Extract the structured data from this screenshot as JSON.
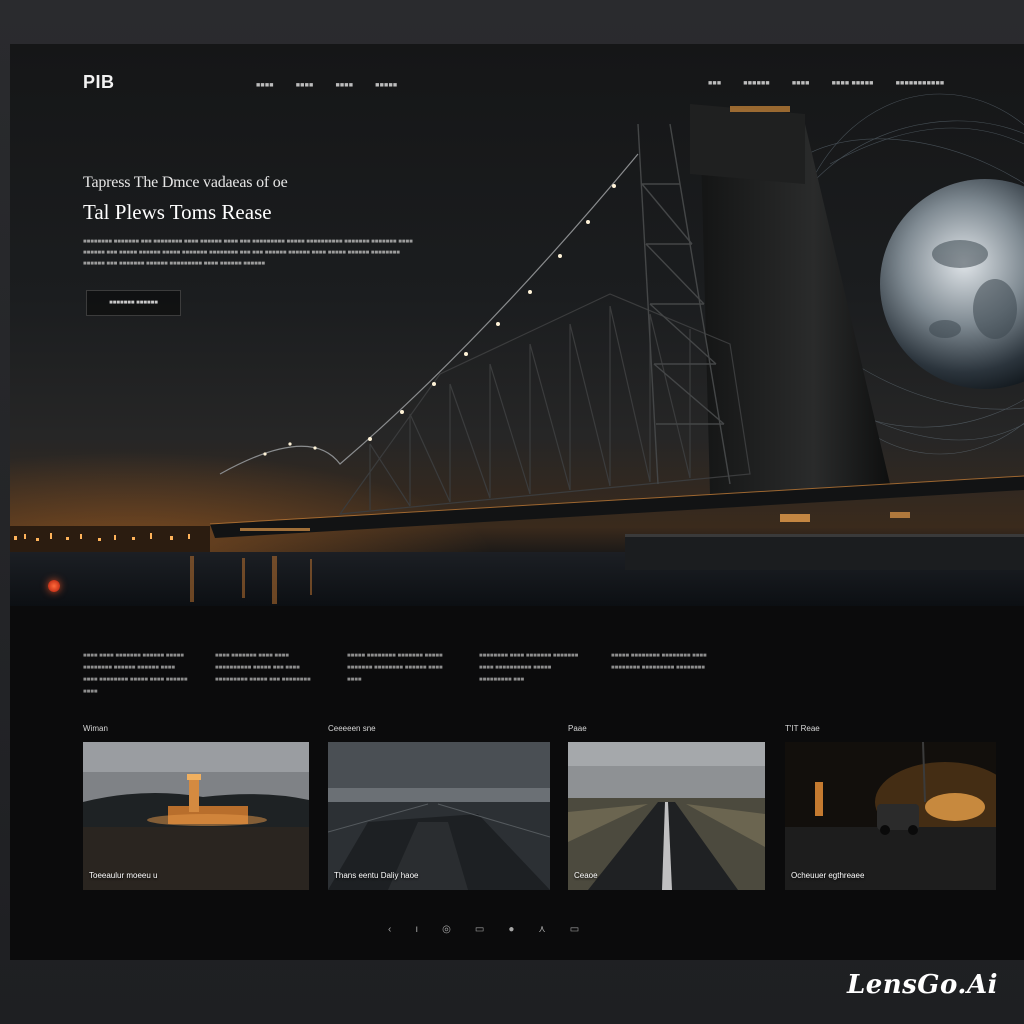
{
  "header": {
    "logo": "PIB",
    "nav_left": [
      "■■■■",
      "■■■■",
      "■■■■",
      "■■■■■"
    ],
    "nav_right": [
      "■■■",
      "■■■■■■",
      "■■■■",
      "■■■■ ■■■■■",
      "■■■■■■■■■■■"
    ]
  },
  "hero": {
    "kicker": "Tapress The Dmce vadaeas of oe",
    "title": "Tal Plews Toms Rease",
    "body": "■■■■■■■■ ■■■■■■■ ■■■ ■■■■■■■■ ■■■■ ■■■■■■ ■■■■ ■■■ ■■■■■■■■■ ■■■■■ ■■■■■■■■■■ ■■■■■■■ ■■■■■■■ ■■■■ ■■■■■■ ■■■ ■■■■■ ■■■■■■ ■■■■■ ■■■■■■■ ■■■■■■■■ ■■■ ■■■ ■■■■■■ ■■■■■■ ■■■■ ■■■■■ ■■■■■■ ■■■■■■■■ ■■■■■■ ■■■ ■■■■■■■ ■■■■■■ ■■■■■■■■■ ■■■■ ■■■■■■ ■■■■■■",
    "cta": "■■■■■■■ ■■■■■■"
  },
  "features": [
    {
      "text": "■■■■ ■■■■ ■■■■■■■ ■■■■■■ ■■■■■ ■■■■■■■■ ■■■■■■ ■■■■■■ ■■■■ ■■■■ ■■■■■■■■ ■■■■■ ■■■■ ■■■■■■ ■■■■"
    },
    {
      "text": "■■■■ ■■■■■■■ ■■■■ ■■■■ ■■■■■■■■■■ ■■■■■ ■■■ ■■■■ ■■■■■■■■■ ■■■■■ ■■■ ■■■■■■■■"
    },
    {
      "text": "■■■■■ ■■■■■■■■ ■■■■■■■ ■■■■■ ■■■■■■■ ■■■■■■■■ ■■■■■■ ■■■■ ■■■■"
    },
    {
      "text": "■■■■■■■■ ■■■■ ■■■■■■■ ■■■■■■■ ■■■■ ■■■■■■■■■■ ■■■■■ ■■■■■■■■■ ■■■"
    },
    {
      "text": "■■■■■ ■■■■■■■■ ■■■■■■■■ ■■■■ ■■■■■■■■ ■■■■■■■■■ ■■■■■■■■"
    }
  ],
  "cards": [
    {
      "label": "Wiman",
      "caption": "Toeeaulur moeeu u",
      "scene": "lighthouse"
    },
    {
      "label": "Ceeeeen sne",
      "caption": "Thans eentu Daliy haoe",
      "scene": "bridge-road"
    },
    {
      "label": "Paae",
      "caption": "Ceaoe",
      "scene": "highway"
    },
    {
      "label": "T'IT Reae",
      "caption": "Ocheuuer egthreaee",
      "scene": "night-car"
    }
  ],
  "pager": [
    "‹",
    "ı",
    "◎",
    "▭",
    "●",
    "⋏",
    "▭"
  ],
  "watermark": "LensGo.Ai",
  "colors": {
    "accent": "#e89a4a",
    "background": "#0b0b0c"
  }
}
